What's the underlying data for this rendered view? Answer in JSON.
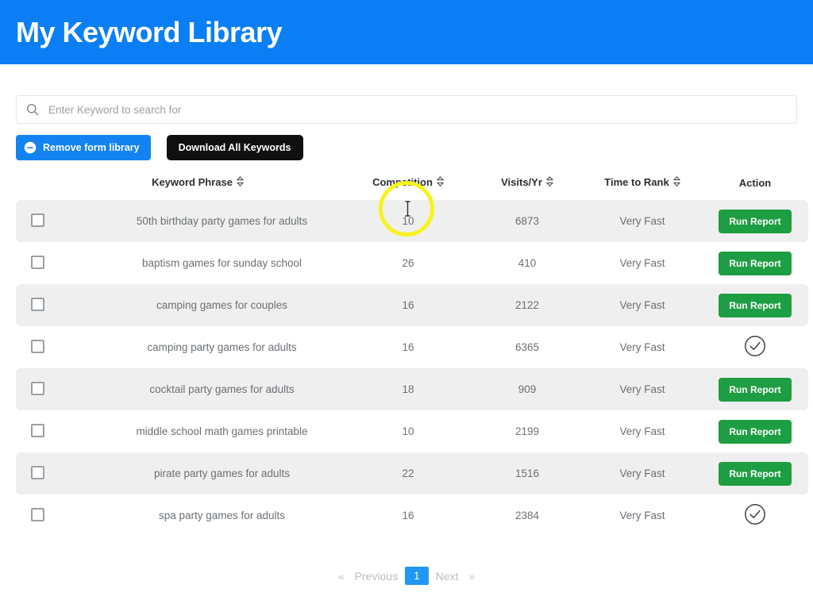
{
  "header": {
    "title": "My Keyword Library",
    "background_color": "#0a7ff5"
  },
  "search": {
    "placeholder": "Enter Keyword to search for",
    "value": "",
    "icon": "search-icon"
  },
  "toolbar": {
    "remove_label": "Remove form library",
    "remove_icon": "minus-circle-icon",
    "remove_color": "#1283f0",
    "download_label": "Download All Keywords",
    "download_color": "#0f0f0f"
  },
  "table": {
    "columns": [
      {
        "key": "select",
        "label": "",
        "sortable": false
      },
      {
        "key": "keyword",
        "label": "Keyword Phrase",
        "sortable": true
      },
      {
        "key": "competition",
        "label": "Competition",
        "sortable": true
      },
      {
        "key": "visits",
        "label": "Visits/Yr",
        "sortable": true
      },
      {
        "key": "rank",
        "label": "Time to Rank",
        "sortable": true
      },
      {
        "key": "action",
        "label": "Action",
        "sortable": false
      }
    ],
    "rows": [
      {
        "keyword": "50th birthday party games for adults",
        "competition": "10",
        "visits": "6873",
        "rank": "Very Fast",
        "action": "Run Report",
        "action_type": "button",
        "checked": false
      },
      {
        "keyword": "baptism games for sunday school",
        "competition": "26",
        "visits": "410",
        "rank": "Very Fast",
        "action": "Run Report",
        "action_type": "button",
        "checked": false
      },
      {
        "keyword": "camping games for couples",
        "competition": "16",
        "visits": "2122",
        "rank": "Very Fast",
        "action": "Run Report",
        "action_type": "button",
        "checked": false
      },
      {
        "keyword": "camping party games for adults",
        "competition": "16",
        "visits": "6365",
        "rank": "Very Fast",
        "action": "check-circle-icon",
        "action_type": "icon",
        "checked": false
      },
      {
        "keyword": "cocktail party games for adults",
        "competition": "18",
        "visits": "909",
        "rank": "Very Fast",
        "action": "Run Report",
        "action_type": "button",
        "checked": false
      },
      {
        "keyword": "middle school math games printable",
        "competition": "10",
        "visits": "2199",
        "rank": "Very Fast",
        "action": "Run Report",
        "action_type": "button",
        "checked": false
      },
      {
        "keyword": "pirate party games for adults",
        "competition": "22",
        "visits": "1516",
        "rank": "Very Fast",
        "action": "Run Report",
        "action_type": "button",
        "checked": false
      },
      {
        "keyword": "spa party games for adults",
        "competition": "16",
        "visits": "2384",
        "rank": "Very Fast",
        "action": "check-circle-icon",
        "action_type": "icon",
        "checked": false
      }
    ],
    "run_report_color": "#1e9e43",
    "stripe_color": "#efefef"
  },
  "pagination": {
    "first_symbol": "«",
    "previous_label": "Previous",
    "pages": [
      "1"
    ],
    "current_page": "1",
    "next_label": "Next",
    "last_symbol": "»",
    "active_color": "#2196f3"
  },
  "cursor": {
    "highlight_color": "#f7f31f",
    "type": "text-cursor"
  }
}
